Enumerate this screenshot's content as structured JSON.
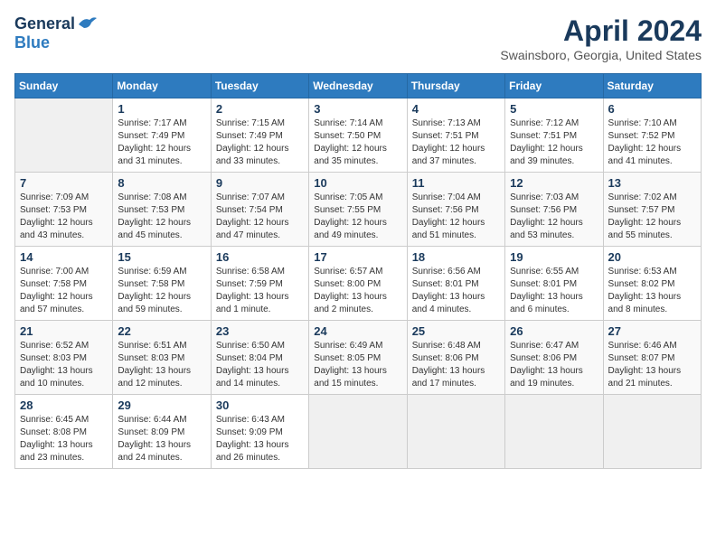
{
  "header": {
    "logo_general": "General",
    "logo_blue": "Blue",
    "month_year": "April 2024",
    "location": "Swainsboro, Georgia, United States"
  },
  "days_of_week": [
    "Sunday",
    "Monday",
    "Tuesday",
    "Wednesday",
    "Thursday",
    "Friday",
    "Saturday"
  ],
  "weeks": [
    [
      {
        "day": "",
        "info": ""
      },
      {
        "day": "1",
        "info": "Sunrise: 7:17 AM\nSunset: 7:49 PM\nDaylight: 12 hours\nand 31 minutes."
      },
      {
        "day": "2",
        "info": "Sunrise: 7:15 AM\nSunset: 7:49 PM\nDaylight: 12 hours\nand 33 minutes."
      },
      {
        "day": "3",
        "info": "Sunrise: 7:14 AM\nSunset: 7:50 PM\nDaylight: 12 hours\nand 35 minutes."
      },
      {
        "day": "4",
        "info": "Sunrise: 7:13 AM\nSunset: 7:51 PM\nDaylight: 12 hours\nand 37 minutes."
      },
      {
        "day": "5",
        "info": "Sunrise: 7:12 AM\nSunset: 7:51 PM\nDaylight: 12 hours\nand 39 minutes."
      },
      {
        "day": "6",
        "info": "Sunrise: 7:10 AM\nSunset: 7:52 PM\nDaylight: 12 hours\nand 41 minutes."
      }
    ],
    [
      {
        "day": "7",
        "info": "Sunrise: 7:09 AM\nSunset: 7:53 PM\nDaylight: 12 hours\nand 43 minutes."
      },
      {
        "day": "8",
        "info": "Sunrise: 7:08 AM\nSunset: 7:53 PM\nDaylight: 12 hours\nand 45 minutes."
      },
      {
        "day": "9",
        "info": "Sunrise: 7:07 AM\nSunset: 7:54 PM\nDaylight: 12 hours\nand 47 minutes."
      },
      {
        "day": "10",
        "info": "Sunrise: 7:05 AM\nSunset: 7:55 PM\nDaylight: 12 hours\nand 49 minutes."
      },
      {
        "day": "11",
        "info": "Sunrise: 7:04 AM\nSunset: 7:56 PM\nDaylight: 12 hours\nand 51 minutes."
      },
      {
        "day": "12",
        "info": "Sunrise: 7:03 AM\nSunset: 7:56 PM\nDaylight: 12 hours\nand 53 minutes."
      },
      {
        "day": "13",
        "info": "Sunrise: 7:02 AM\nSunset: 7:57 PM\nDaylight: 12 hours\nand 55 minutes."
      }
    ],
    [
      {
        "day": "14",
        "info": "Sunrise: 7:00 AM\nSunset: 7:58 PM\nDaylight: 12 hours\nand 57 minutes."
      },
      {
        "day": "15",
        "info": "Sunrise: 6:59 AM\nSunset: 7:58 PM\nDaylight: 12 hours\nand 59 minutes."
      },
      {
        "day": "16",
        "info": "Sunrise: 6:58 AM\nSunset: 7:59 PM\nDaylight: 13 hours\nand 1 minute."
      },
      {
        "day": "17",
        "info": "Sunrise: 6:57 AM\nSunset: 8:00 PM\nDaylight: 13 hours\nand 2 minutes."
      },
      {
        "day": "18",
        "info": "Sunrise: 6:56 AM\nSunset: 8:01 PM\nDaylight: 13 hours\nand 4 minutes."
      },
      {
        "day": "19",
        "info": "Sunrise: 6:55 AM\nSunset: 8:01 PM\nDaylight: 13 hours\nand 6 minutes."
      },
      {
        "day": "20",
        "info": "Sunrise: 6:53 AM\nSunset: 8:02 PM\nDaylight: 13 hours\nand 8 minutes."
      }
    ],
    [
      {
        "day": "21",
        "info": "Sunrise: 6:52 AM\nSunset: 8:03 PM\nDaylight: 13 hours\nand 10 minutes."
      },
      {
        "day": "22",
        "info": "Sunrise: 6:51 AM\nSunset: 8:03 PM\nDaylight: 13 hours\nand 12 minutes."
      },
      {
        "day": "23",
        "info": "Sunrise: 6:50 AM\nSunset: 8:04 PM\nDaylight: 13 hours\nand 14 minutes."
      },
      {
        "day": "24",
        "info": "Sunrise: 6:49 AM\nSunset: 8:05 PM\nDaylight: 13 hours\nand 15 minutes."
      },
      {
        "day": "25",
        "info": "Sunrise: 6:48 AM\nSunset: 8:06 PM\nDaylight: 13 hours\nand 17 minutes."
      },
      {
        "day": "26",
        "info": "Sunrise: 6:47 AM\nSunset: 8:06 PM\nDaylight: 13 hours\nand 19 minutes."
      },
      {
        "day": "27",
        "info": "Sunrise: 6:46 AM\nSunset: 8:07 PM\nDaylight: 13 hours\nand 21 minutes."
      }
    ],
    [
      {
        "day": "28",
        "info": "Sunrise: 6:45 AM\nSunset: 8:08 PM\nDaylight: 13 hours\nand 23 minutes."
      },
      {
        "day": "29",
        "info": "Sunrise: 6:44 AM\nSunset: 8:09 PM\nDaylight: 13 hours\nand 24 minutes."
      },
      {
        "day": "30",
        "info": "Sunrise: 6:43 AM\nSunset: 9:09 PM\nDaylight: 13 hours\nand 26 minutes."
      },
      {
        "day": "",
        "info": ""
      },
      {
        "day": "",
        "info": ""
      },
      {
        "day": "",
        "info": ""
      },
      {
        "day": "",
        "info": ""
      }
    ]
  ]
}
